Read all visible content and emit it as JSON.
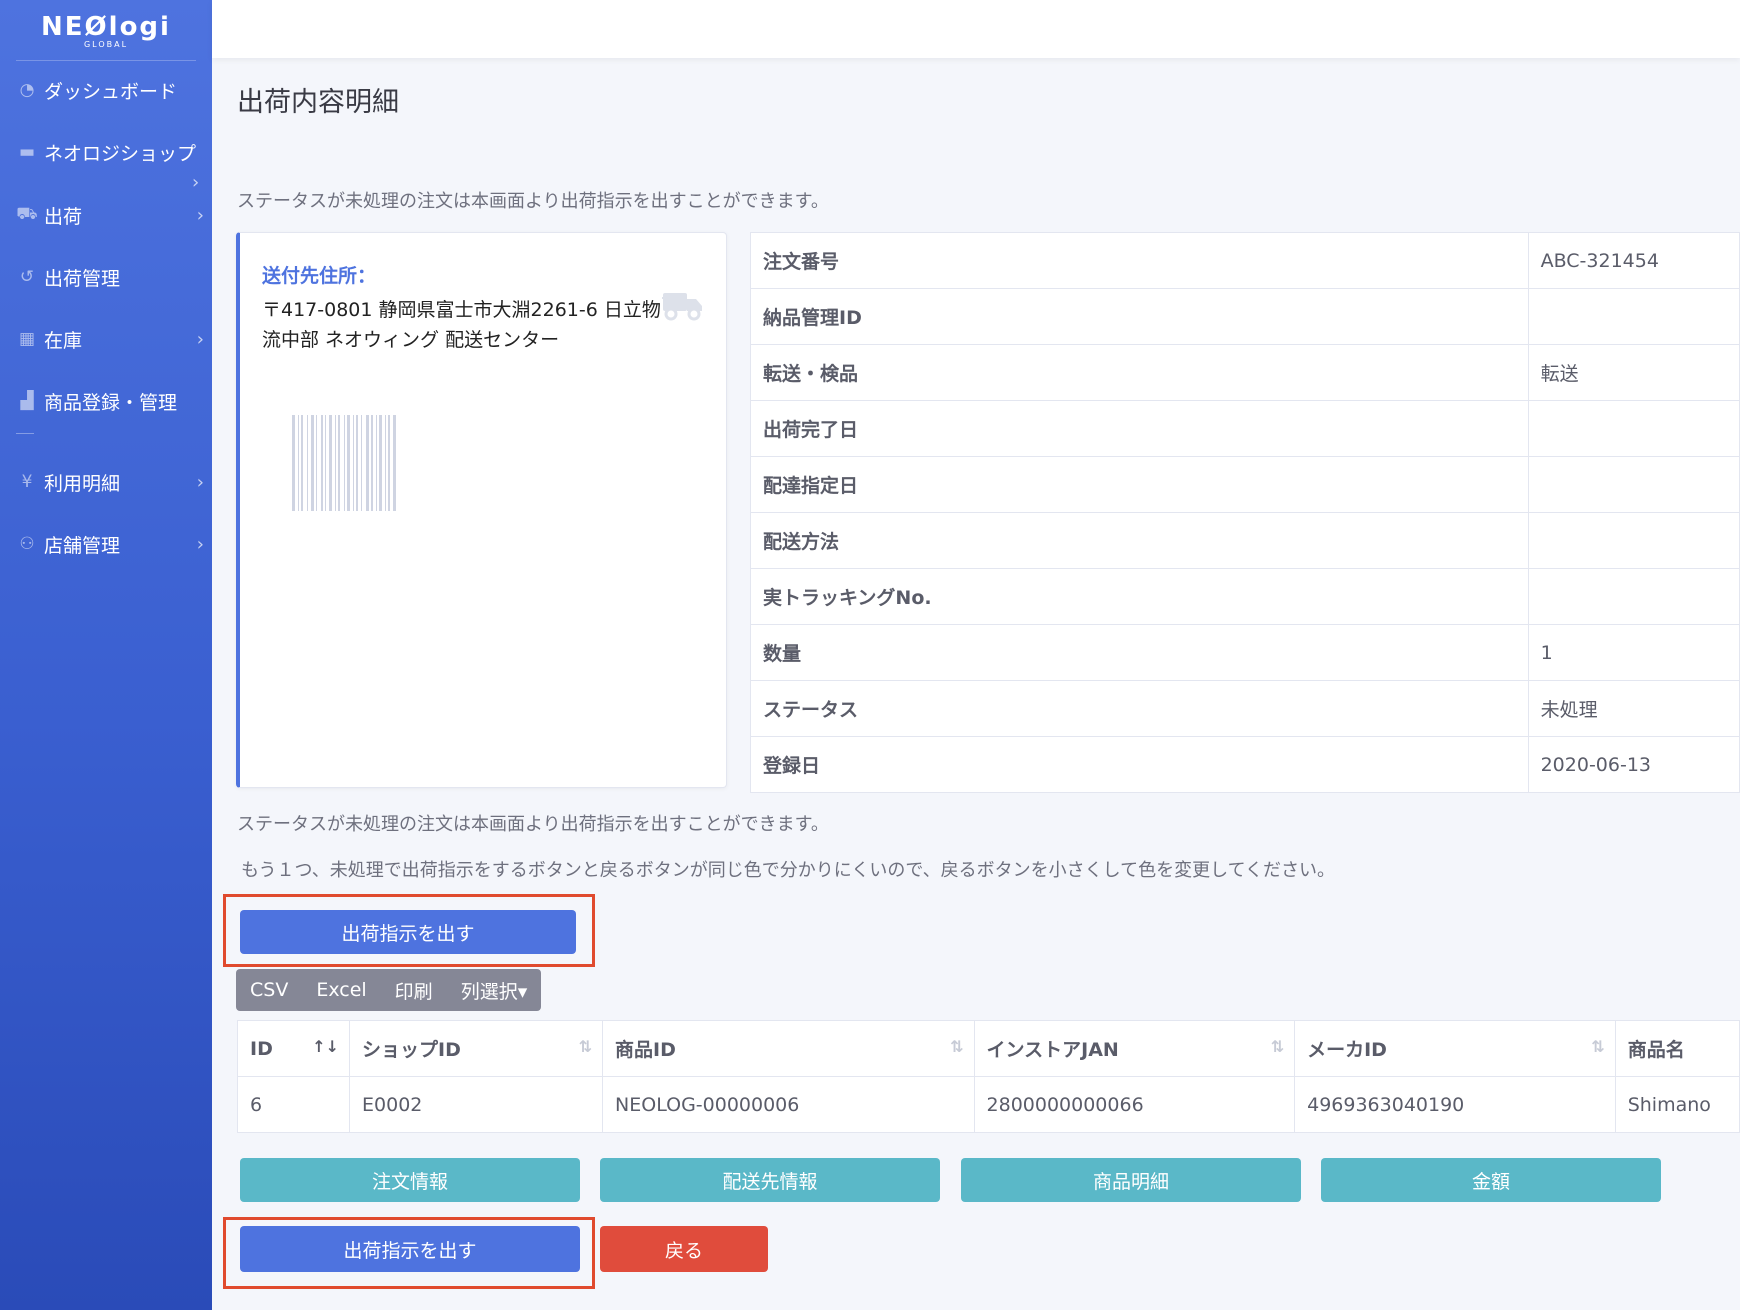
{
  "brand": {
    "name": "NEØlogi",
    "sub": "GLOBAL"
  },
  "sidebar": {
    "items": [
      {
        "label": "ダッシュボード",
        "icon": "tachometer-icon"
      },
      {
        "label": "ネオロジショップ",
        "icon": "store-icon"
      },
      {
        "label": "出荷",
        "icon": "truck-icon"
      },
      {
        "label": "出荷管理",
        "icon": "history-icon"
      },
      {
        "label": "在庫",
        "icon": "warehouse-icon"
      },
      {
        "label": "商品登録・管理",
        "icon": "boxes-icon"
      },
      {
        "label": "利用明細",
        "icon": "yen-icon"
      },
      {
        "label": "店舗管理",
        "icon": "users-icon"
      }
    ]
  },
  "page": {
    "title": "出荷内容明細",
    "note_top": "ステータスが未処理の注文は本画面より出荷指示を出すことができます。",
    "note_mid": "ステータスが未処理の注文は本画面より出荷指示を出すことができます。",
    "note_request": "もう１つ、未処理で出荷指示をするボタンと戻るボタンが同じ色で分かりにくいので、戻るボタンを小さくして色を変更してください。"
  },
  "address": {
    "label": "送付先住所：",
    "text": "〒417-0801 静岡県富士市大淵2261-6 日立物流中部 ネオウィング 配送センター"
  },
  "details": [
    {
      "key": "注文番号",
      "value": "ABC-321454"
    },
    {
      "key": "納品管理ID",
      "value": ""
    },
    {
      "key": "転送・検品",
      "value": "転送"
    },
    {
      "key": "出荷完了日",
      "value": ""
    },
    {
      "key": "配達指定日",
      "value": ""
    },
    {
      "key": "配送方法",
      "value": ""
    },
    {
      "key": "実トラッキングNo.",
      "value": ""
    },
    {
      "key": "数量",
      "value": "1"
    },
    {
      "key": "ステータス",
      "value": "未処理"
    },
    {
      "key": "登録日",
      "value": "2020-06-13"
    }
  ],
  "buttons": {
    "ship_top": "出荷指示を出す",
    "ship_bottom": "出荷指示を出す",
    "back": "戻る",
    "order_info": "注文情報",
    "shipping_info": "配送先情報",
    "product_detail": "商品明細",
    "amount": "金額"
  },
  "toolbar": {
    "csv": "CSV",
    "excel": "Excel",
    "print": "印刷",
    "columns": "列選択▾"
  },
  "table": {
    "headers": [
      "ID",
      "ショップID",
      "商品ID",
      "インストアJAN",
      "メーカID",
      "商品名"
    ],
    "rows": [
      [
        "6",
        "E0002",
        "NEOLOG-00000006",
        "2800000000066",
        "4969363040190",
        "Shimano"
      ]
    ]
  },
  "colors": {
    "primary": "#4e73df",
    "info": "#5ab8c8",
    "danger": "#e04c3c",
    "highlight": "#e04a2e"
  }
}
